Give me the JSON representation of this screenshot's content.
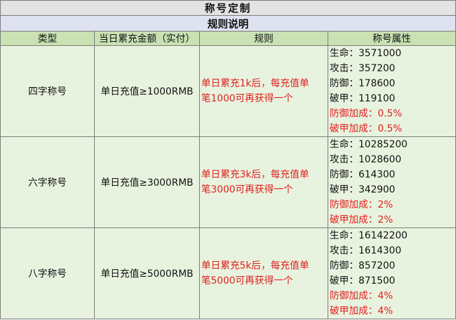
{
  "title": "称号定制",
  "subtitle": "规则说明",
  "columns": [
    "类型",
    "当日累充金额（实付）",
    "规则",
    "称号属性"
  ],
  "rows": [
    {
      "type": "四字称号",
      "condition": "单日充值≥1000RMB",
      "rule_lines": [
        "单日累充1k后，每充值单",
        "笔1000可再获得一个"
      ],
      "attributes": [
        "生命：3571000",
        "攻击：357200",
        "防御：178600",
        "破甲：119100"
      ],
      "bonus": [
        "防御加成：0.5%",
        "破甲加成：0.5%"
      ]
    },
    {
      "type": "六字称号",
      "condition": "单日充值≥3000RMB",
      "rule_lines": [
        "单日累充3k后，每充值单",
        "笔3000可再获得一个"
      ],
      "attributes": [
        "生命：10285200",
        "攻击：1028600",
        "防御：614300",
        "破甲：342900"
      ],
      "bonus": [
        "防御加成：2%",
        "破甲加成：2%"
      ]
    },
    {
      "type": "八字称号",
      "condition": "单日充值≥5000RMB",
      "rule_lines": [
        "单日累充5k后，每充值单",
        "笔5000可再获得一个"
      ],
      "attributes": [
        "生命：16142200",
        "攻击：1614300",
        "防御：857200",
        "破甲：871500"
      ],
      "bonus": [
        "防御加成：4%",
        "破甲加成：4%"
      ]
    }
  ],
  "colors": {
    "title_bg": "#e3e3e3",
    "subtitle_bg": "#dfe2f1",
    "header_bg": "#c9e1b3",
    "body_bg": "#e8f3df",
    "highlight_text": "#e01e1e"
  }
}
